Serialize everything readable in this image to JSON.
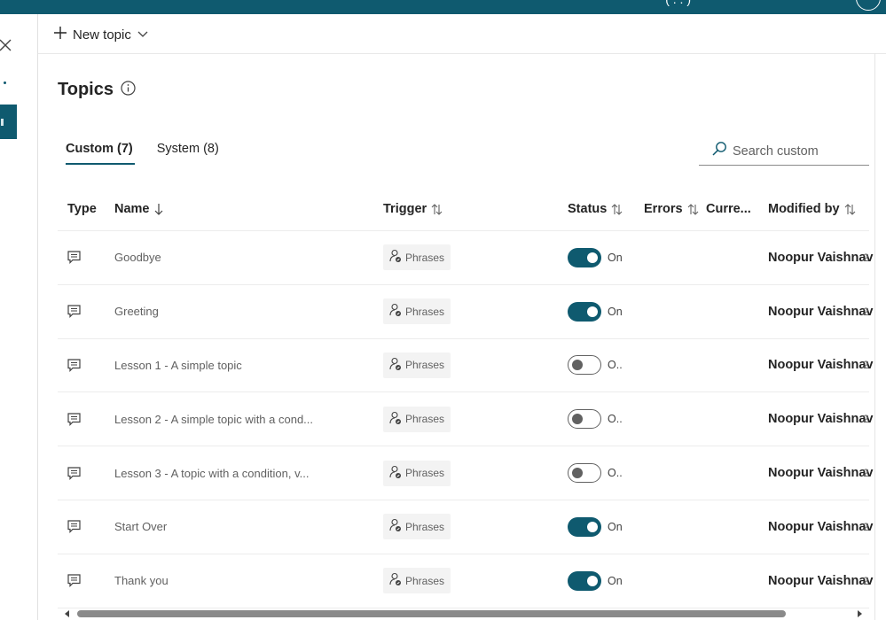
{
  "topbar": {
    "partial_text": "(  .  .  )"
  },
  "command_bar": {
    "new_topic_label": "New topic"
  },
  "page": {
    "title": "Topics"
  },
  "tabs": [
    {
      "label": "Custom (7)",
      "active": true
    },
    {
      "label": "System (8)",
      "active": false
    }
  ],
  "search": {
    "placeholder": "Search custom"
  },
  "table": {
    "columns": {
      "type": "Type",
      "name": "Name",
      "trigger": "Trigger",
      "status": "Status",
      "errors": "Errors",
      "current": "Curre...",
      "modified_by": "Modified by"
    },
    "rows": [
      {
        "name": "Goodbye",
        "trigger": "Phrases",
        "status_on": true,
        "status_label": "On",
        "modified_by": "Noopur Vaishnav",
        "overflow": "2"
      },
      {
        "name": "Greeting",
        "trigger": "Phrases",
        "status_on": true,
        "status_label": "On",
        "modified_by": "Noopur Vaishnav",
        "overflow": "2"
      },
      {
        "name": "Lesson 1 - A simple topic",
        "trigger": "Phrases",
        "status_on": false,
        "status_label": "O..",
        "modified_by": "Noopur Vaishnav",
        "overflow": "2"
      },
      {
        "name": "Lesson 2 - A simple topic with a cond...",
        "trigger": "Phrases",
        "status_on": false,
        "status_label": "O..",
        "modified_by": "Noopur Vaishnav",
        "overflow": "2"
      },
      {
        "name": "Lesson 3 - A topic with a condition, v...",
        "trigger": "Phrases",
        "status_on": false,
        "status_label": "O..",
        "modified_by": "Noopur Vaishnav",
        "overflow": "2"
      },
      {
        "name": "Start Over",
        "trigger": "Phrases",
        "status_on": true,
        "status_label": "On",
        "modified_by": "Noopur Vaishnav",
        "overflow": "2"
      },
      {
        "name": "Thank you",
        "trigger": "Phrases",
        "status_on": true,
        "status_label": "On",
        "modified_by": "Noopur Vaishnav",
        "overflow": "2"
      }
    ]
  },
  "colors": {
    "brand": "#0f5a6f",
    "muted_text": "#616161",
    "chip_bg": "#f3f3f3"
  },
  "icons": {
    "close": "close-icon",
    "add": "plus-icon",
    "dropdown": "chevron-down-icon",
    "info": "info-icon",
    "search": "search-icon",
    "sort_desc": "arrow-down-icon",
    "sort": "sort-icon",
    "topic": "chat-bubble-icon",
    "trigger": "phrases-trigger-icon"
  }
}
